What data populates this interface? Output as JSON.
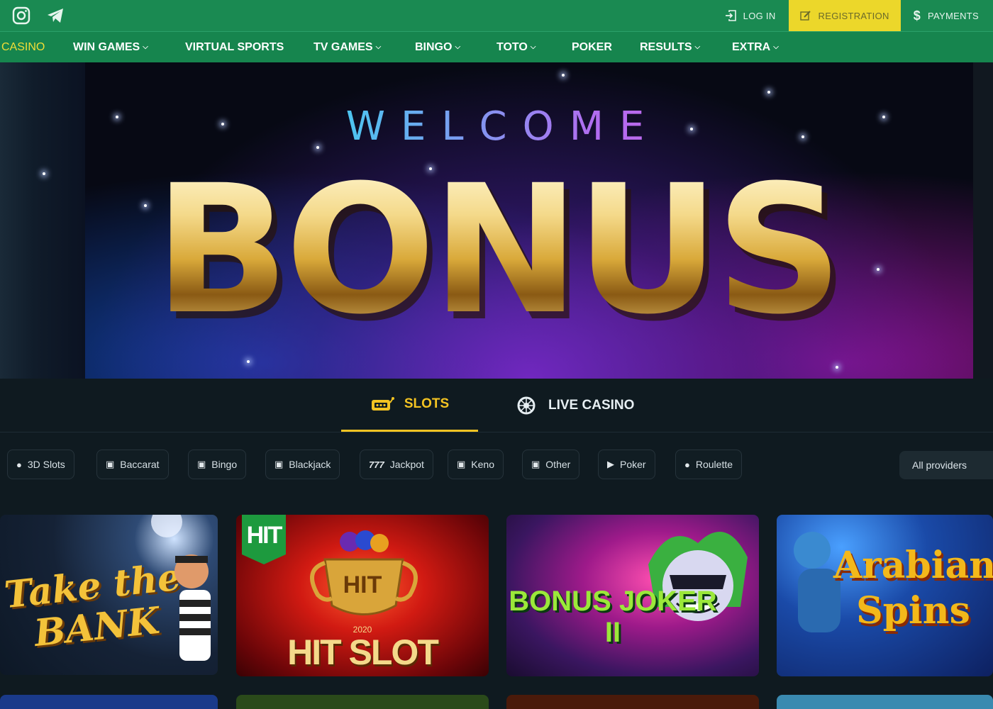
{
  "topbar": {
    "social": [
      {
        "icon": "instagram-icon"
      },
      {
        "icon": "telegram-icon"
      }
    ],
    "login_label": "LOG IN",
    "register_label": "REGISTRATION",
    "payments_label": "PAYMENTS"
  },
  "nav": {
    "items": [
      {
        "label": "CASINO",
        "active": true,
        "dropdown": false
      },
      {
        "label": "WIN GAMES",
        "dropdown": true
      },
      {
        "label": "VIRTUAL SPORTS",
        "dropdown": false
      },
      {
        "label": "TV GAMES",
        "dropdown": true
      },
      {
        "label": "BINGO",
        "dropdown": true
      },
      {
        "label": "TOTO",
        "dropdown": true
      },
      {
        "label": "POKER",
        "dropdown": false
      },
      {
        "label": "RESULTS",
        "dropdown": true
      },
      {
        "label": "EXTRA",
        "dropdown": true
      }
    ]
  },
  "banner": {
    "welcome": "WELCOME",
    "bonus": "BONUS"
  },
  "tabs": [
    {
      "label": "SLOTS",
      "icon": "slot-machine-icon",
      "active": true
    },
    {
      "label": "LIVE CASINO",
      "icon": "roulette-wheel-icon",
      "active": false
    }
  ],
  "filters": {
    "chips": [
      {
        "label": "3D Slots",
        "icon": "dot-icon"
      },
      {
        "label": "Baccarat",
        "icon": "slot-icon"
      },
      {
        "label": "Bingo",
        "icon": "slot-icon"
      },
      {
        "label": "Blackjack",
        "icon": "slot-icon"
      },
      {
        "label": "Jackpot",
        "icon": "777-icon",
        "glyph": "777"
      },
      {
        "label": "Keno",
        "icon": "slot-icon"
      },
      {
        "label": "Other",
        "icon": "slot-icon"
      },
      {
        "label": "Poker",
        "icon": "play-icon"
      },
      {
        "label": "Roulette",
        "icon": "dot-icon"
      }
    ],
    "providers_label": "All providers"
  },
  "games": [
    {
      "title": "Take the BANK"
    },
    {
      "title": "HIT SLOT",
      "badge": "HIT",
      "subtitle": "2020",
      "cup_label": "HIT"
    },
    {
      "title": "BONUS JOKER II"
    },
    {
      "title": "Arabian Spins"
    }
  ],
  "colors": {
    "brand_green": "#1a8a52",
    "register_yellow": "#ecd72a",
    "active_tab": "#f3c322",
    "nav_active": "#f0de37"
  }
}
